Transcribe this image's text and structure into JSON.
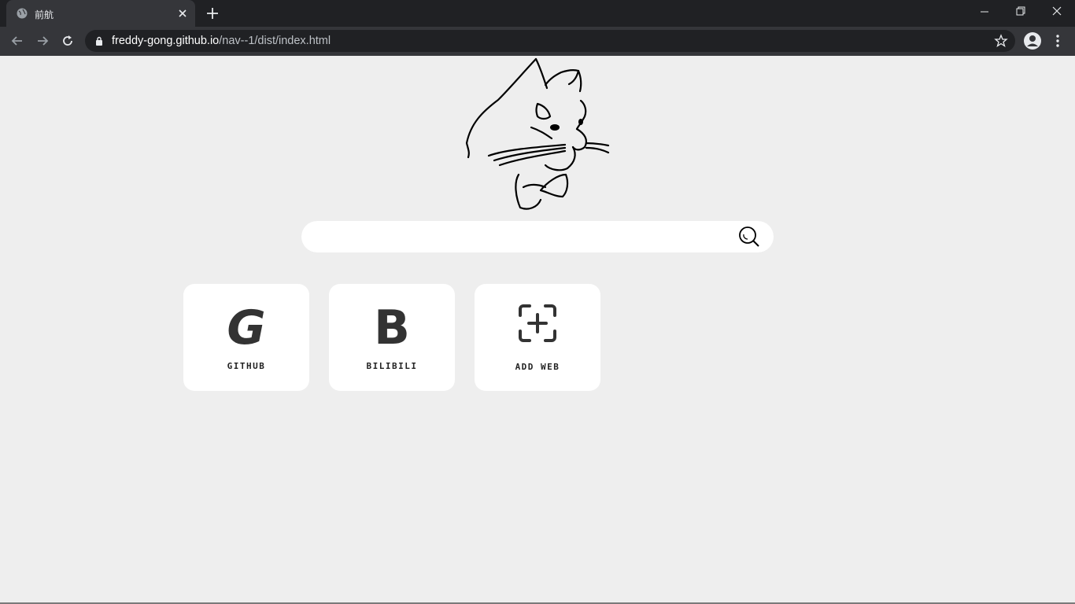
{
  "browser": {
    "tab_title": "前航",
    "url_host": "freddy-gong.github.io",
    "url_path": "/nav--1/dist/index.html",
    "icons": [
      "globe-icon",
      "close-icon",
      "plus-icon",
      "minimize-icon",
      "restore-icon",
      "close-window-icon",
      "back-icon",
      "forward-icon",
      "reload-icon",
      "lock-icon",
      "star-icon",
      "profile-icon",
      "menu-icon"
    ]
  },
  "search": {
    "placeholder": "",
    "icon": "search-icon"
  },
  "sites": [
    {
      "letter": "G",
      "label": "GITHUB"
    },
    {
      "letter": "B",
      "label": "BILIBILI"
    }
  ],
  "add_site": {
    "label": "ADD WEB",
    "icon": "add-icon"
  }
}
